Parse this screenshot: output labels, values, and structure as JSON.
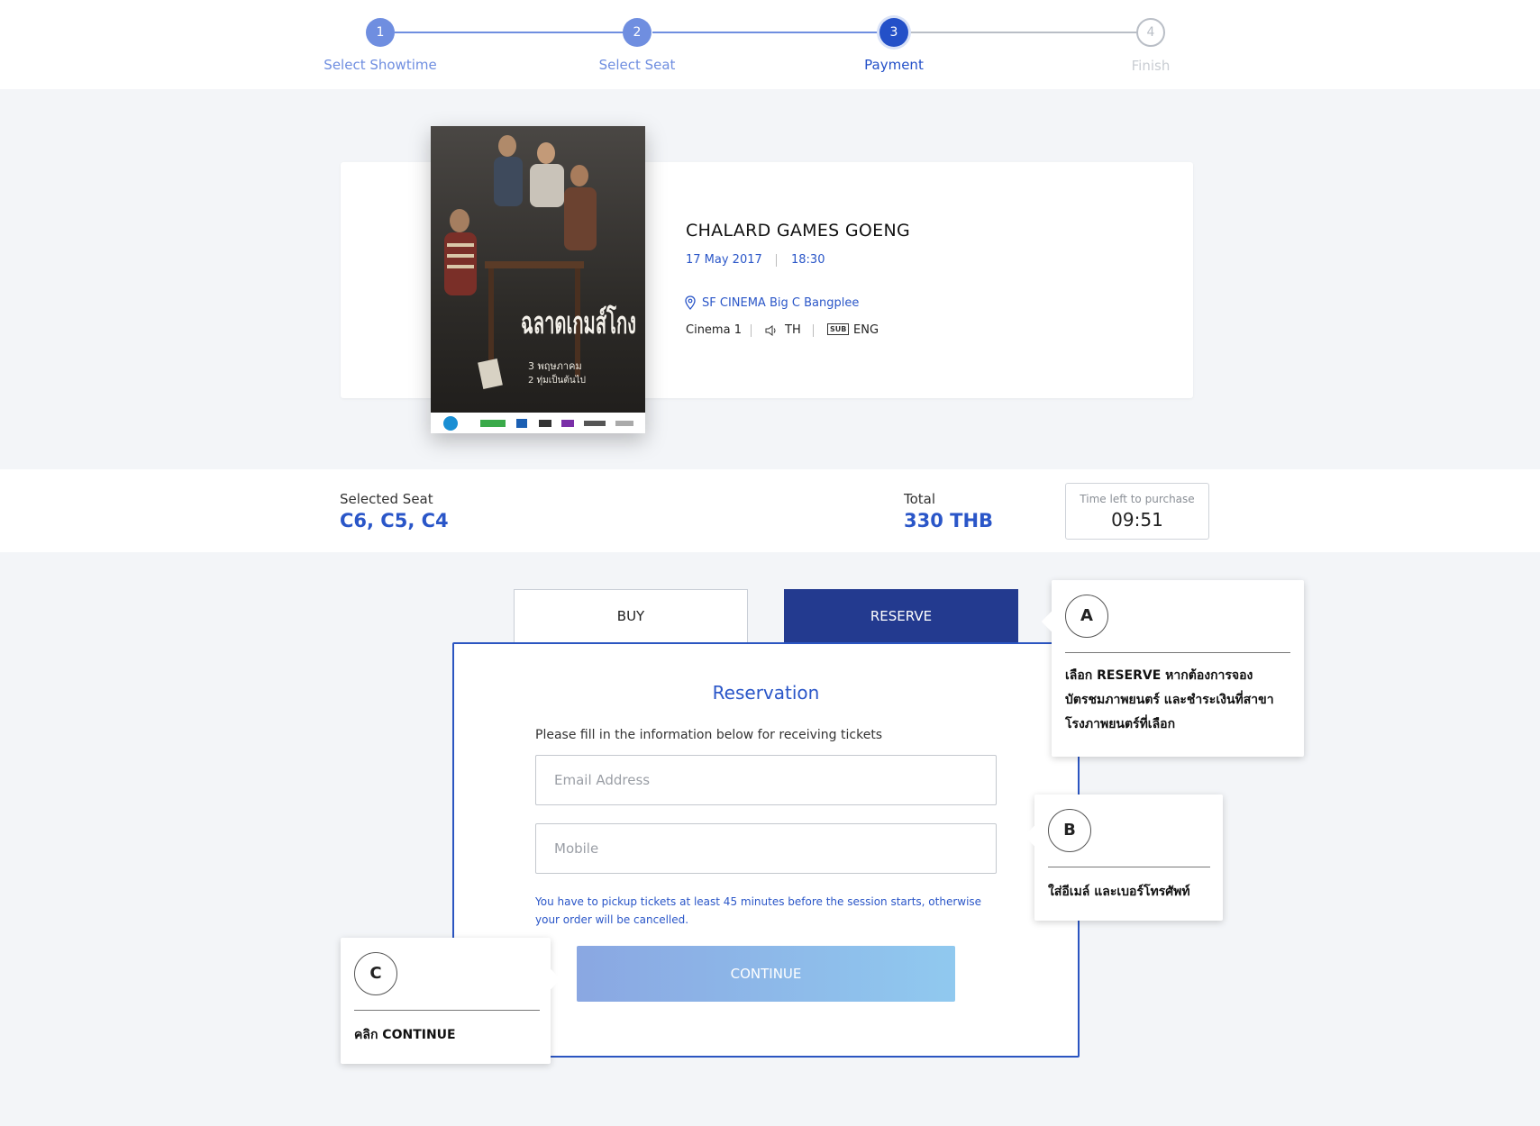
{
  "stepper": {
    "steps": [
      {
        "number": "1",
        "label": "Select Showtime"
      },
      {
        "number": "2",
        "label": "Select Seat"
      },
      {
        "number": "3",
        "label": "Payment"
      },
      {
        "number": "4",
        "label": "Finish"
      }
    ],
    "current_step": 3
  },
  "movie": {
    "title": "CHALARD GAMES GOENG",
    "date": "17 May 2017",
    "time": "18:30",
    "cinema_name": "SF CINEMA Big C Bangplee",
    "hall": "Cinema 1",
    "audio": "TH",
    "subtitle_badge": "SUB",
    "subtitle": "ENG",
    "poster": {
      "title_text": "ฉลาดเกมส์โกง",
      "date_line": "3 พฤษภาคม",
      "tagline": "2 ทุ่มเป็นต้นไป"
    }
  },
  "summary": {
    "selected_seat_label": "Selected Seat",
    "selected_seats": "C6, C5, C4",
    "total_label": "Total",
    "total_value": "330 THB",
    "timer_label": "Time left to purchase",
    "timer_value": "09:51"
  },
  "tabs": {
    "buy_label": "BUY",
    "reserve_label": "RESERVE",
    "active": "RESERVE"
  },
  "form": {
    "heading": "Reservation",
    "instructions": "Please fill in the information below for receiving tickets",
    "email_placeholder": "Email Address",
    "email_value": "",
    "mobile_placeholder": "Mobile",
    "mobile_value": "",
    "notice_line1": "You have to pickup tickets at least 45 minutes before the session starts, otherwise",
    "notice_line2": "your order will be cancelled.",
    "continue_label": "CONTINUE"
  },
  "callouts": {
    "a": {
      "badge": "A",
      "line1": "เลือก RESERVE หากต้องการจอง",
      "line2": "บัตรชมภาพยนตร์ และชำระเงินที่สาขา",
      "line3": "โรงภาพยนตร์ที่เลือก"
    },
    "b": {
      "badge": "B",
      "line1": "ใส่อีเมล์ และเบอร์โทรศัพท์"
    },
    "c": {
      "badge": "C",
      "line1": "คลิก CONTINUE"
    }
  },
  "colors": {
    "accent_blue": "#2a56c8",
    "step_done": "#6f8ee0",
    "step_active": "#2350c8",
    "step_todo": "#b9bec6",
    "reserve_tab": "#233a8f",
    "panel_border": "#2b55c1"
  },
  "icons": {
    "location": "map-pin-icon",
    "audio": "speaker-icon",
    "subtitle": "sub-badge-icon"
  }
}
